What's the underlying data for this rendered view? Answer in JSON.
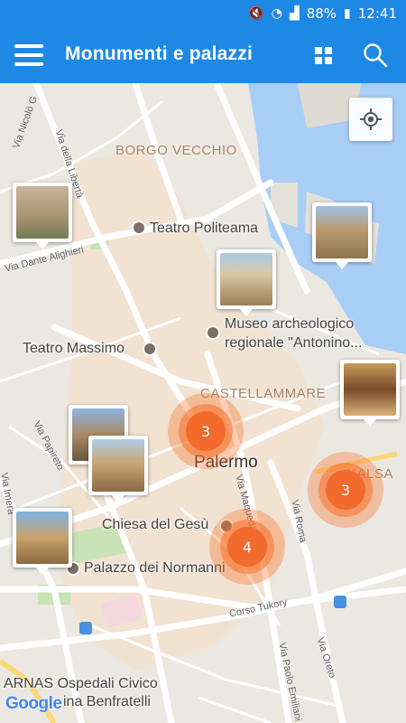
{
  "status_bar": {
    "battery": "88%",
    "time": "12:41"
  },
  "app_bar": {
    "title": "Monumenti e palazzi"
  },
  "map": {
    "districts": [
      "BORGO VECCHIO",
      "CASTELLAMMARE",
      "KALSA"
    ],
    "city": "Palermo",
    "pois": [
      {
        "name": "Teatro Politeama"
      },
      {
        "name": "Museo archeologico",
        "name2": "regionale \"Antonino..."
      },
      {
        "name": "Teatro Massimo"
      },
      {
        "name": "Chiesa del Gesù"
      },
      {
        "name": "Palazzo dei Normanni"
      },
      {
        "name": "ARNAS Ospedali Civico",
        "name2": "ina Benfratelli"
      }
    ],
    "streets": [
      "Via Nicolò G",
      "Via della Libertà",
      "Via Dante Alighieri",
      "Via Papireto",
      "Via Imera",
      "Via Maqueda",
      "Via Roma",
      "Corso Tukory",
      "Via Oreto",
      "Via Paolo Emiliani Gi"
    ],
    "clusters": [
      {
        "count": "3"
      },
      {
        "count": "3"
      },
      {
        "count": "4"
      }
    ],
    "attribution": "Google"
  },
  "colors": {
    "primary": "#1e88e5",
    "cluster": "#f26a2c",
    "water": "#a8cef6"
  }
}
